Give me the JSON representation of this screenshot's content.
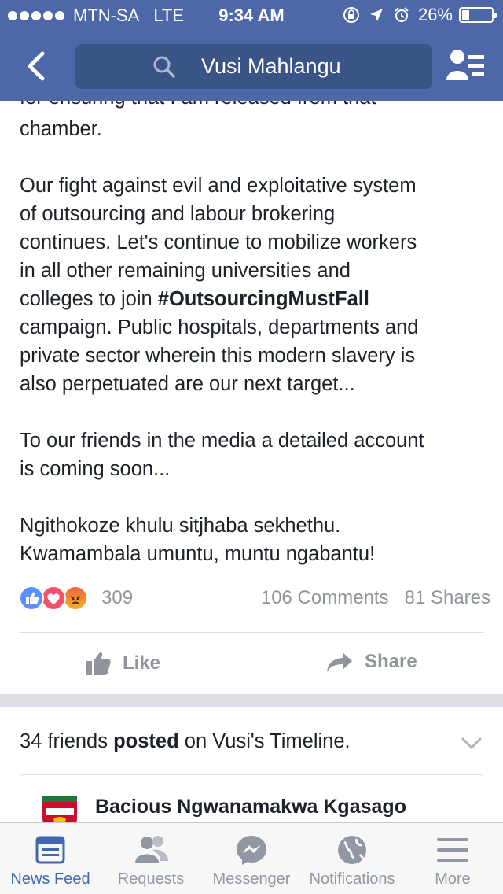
{
  "status_bar": {
    "carrier": "MTN-SA",
    "network": "LTE",
    "time": "9:34 AM",
    "battery": "26%"
  },
  "nav": {
    "search_query": "Vusi Mahlangu"
  },
  "post": {
    "cut_line": "for ensuring that I am released from that",
    "line_chamber": "chamber.",
    "para2": [
      "Our fight against evil and exploitative system",
      "of outsourcing and labour brokering",
      "continues. Let's continue to mobilize workers",
      "in all other remaining universities and"
    ],
    "para2_line5_prefix": "colleges to join ",
    "hashtag": "#OutsourcingMustFall",
    "para2_rest": [
      "campaign. Public hospitals, departments and",
      "private sector wherein this modern slavery is",
      "also perpetuated are our next target..."
    ],
    "para3": [
      "To our friends in the media a detailed account",
      "is coming soon..."
    ],
    "para4": [
      "Ngithokoze khulu sitjhaba sekhethu.",
      "Kwamambala umuntu, muntu ngabantu!"
    ]
  },
  "engagement": {
    "reactions_count": "309",
    "comments": "106 Comments",
    "shares": "81 Shares"
  },
  "actions": {
    "like": "Like",
    "share": "Share"
  },
  "timeline": {
    "prefix": "34 friends ",
    "posted": "posted",
    "suffix": " on Vusi's Timeline."
  },
  "card": {
    "name": "Bacious Ngwanamakwa Kgasago"
  },
  "tabs": [
    {
      "label": "News Feed",
      "icon": "news-feed-icon"
    },
    {
      "label": "Requests",
      "icon": "requests-icon"
    },
    {
      "label": "Messenger",
      "icon": "messenger-icon"
    },
    {
      "label": "Notifications",
      "icon": "notifications-icon"
    },
    {
      "label": "More",
      "icon": "more-icon"
    }
  ],
  "colors": {
    "brand": "#4c68a8",
    "accent": "#4267b2",
    "muted": "#90949c"
  }
}
